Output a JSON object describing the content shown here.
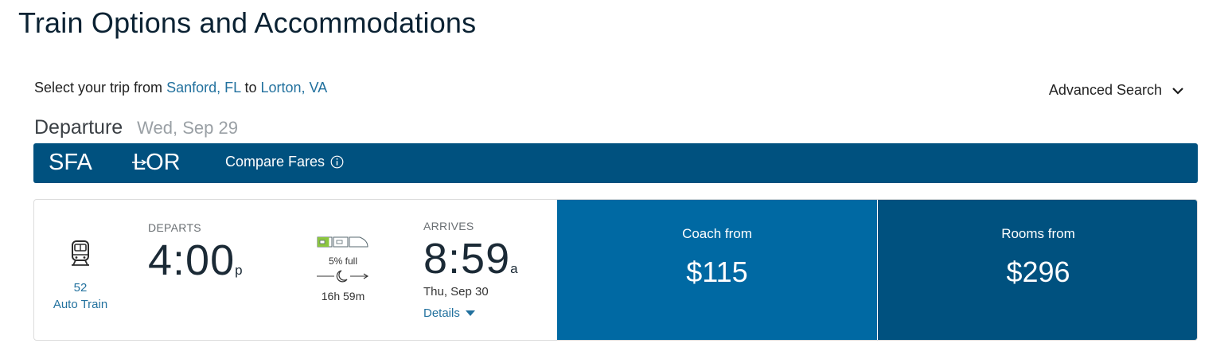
{
  "page": {
    "title": "Train Options and Accommodations"
  },
  "trip": {
    "prefix": "Select your trip from",
    "origin": "Sanford, FL",
    "connector": "to",
    "destination": "Lorton, VA"
  },
  "advanced_search": {
    "label": "Advanced Search",
    "icon": "chevron-down-icon"
  },
  "departure": {
    "label": "Departure",
    "date": "Wed, Sep 29"
  },
  "route": {
    "from_code": "SFA",
    "arrow": "→",
    "to_code": "LOR",
    "compare_label": "Compare Fares",
    "info_icon": "info-icon",
    "bar_color": "#00517f"
  },
  "train": {
    "icon": "train-icon",
    "number": "52",
    "name": "Auto Train",
    "departs_label": "DEPARTS",
    "depart_time": "4:00",
    "depart_ampm": "p",
    "occupancy_text": "5% full",
    "occupancy_fraction": 0.05,
    "duration": "16h 59m",
    "overnight_icon": "moon-icon",
    "arrives_label": "ARRIVES",
    "arrive_time": "8:59",
    "arrive_ampm": "a",
    "arrive_date": "Thu, Sep 30",
    "details_label": "Details"
  },
  "fares": [
    {
      "label": "Coach from",
      "price": "$115",
      "color": "#0069a3"
    },
    {
      "label": "Rooms from",
      "price": "$296",
      "color": "#00517f"
    }
  ]
}
